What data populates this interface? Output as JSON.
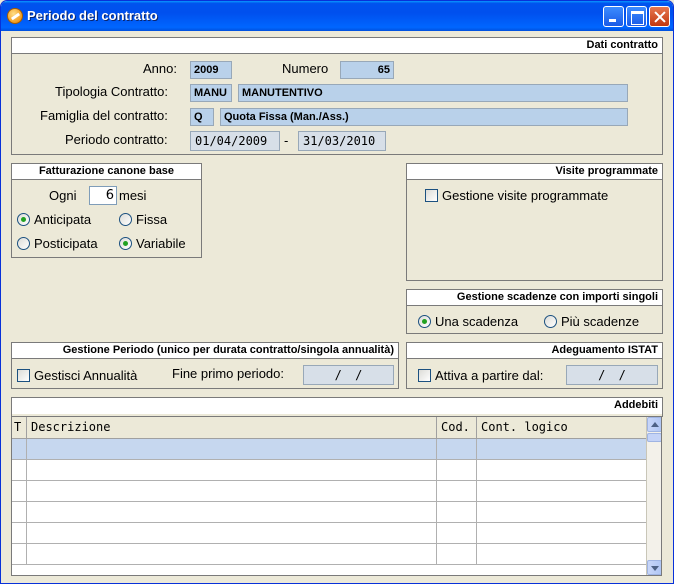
{
  "window": {
    "title": "Periodo del contratto"
  },
  "dati_contratto": {
    "header": "Dati contratto",
    "anno_label": "Anno:",
    "anno_value": "2009",
    "numero_label": "Numero",
    "numero_value": "65",
    "tipologia_label": "Tipologia Contratto:",
    "tipologia_code": "MANU",
    "tipologia_desc": "MANUTENTIVO",
    "famiglia_label": "Famiglia del contratto:",
    "famiglia_code": "Q",
    "famiglia_desc": "Quota Fissa (Man./Ass.)",
    "periodo_label": "Periodo contratto:",
    "periodo_from": "01/04/2009",
    "periodo_sep": "-",
    "periodo_to": "31/03/2010"
  },
  "fatturazione": {
    "header": "Fatturazione canone base",
    "ogni_label": "Ogni",
    "ogni_value": "6",
    "mesi_label": "mesi",
    "opt_anticipata": "Anticipata",
    "opt_fissa": "Fissa",
    "opt_posticipata": "Posticipata",
    "opt_variabile": "Variabile",
    "timing_selected": "Anticipata",
    "amount_selected": "Variabile"
  },
  "visite": {
    "header": "Visite programmate",
    "gestione_label": "Gestione visite programmate",
    "gestione_checked": false
  },
  "scadenze": {
    "header": "Gestione scadenze con importi singoli",
    "opt_una": "Una scadenza",
    "opt_piu": "Più scadenze",
    "selected": "Una scadenza"
  },
  "gestione_periodo": {
    "header": "Gestione Periodo (unico per durata contratto/singola annualità)",
    "gestisci_label": "Gestisci Annualità",
    "gestisci_checked": false,
    "fine_label": "Fine primo periodo:",
    "fine_value": "/ /"
  },
  "istat": {
    "header": "Adeguamento ISTAT",
    "attiva_label": "Attiva a partire dal:",
    "attiva_checked": false,
    "attiva_value": "/ /"
  },
  "addebiti": {
    "header": "Addebiti",
    "columns": [
      "T",
      "Descrizione",
      "Cod.",
      "Cont. logico"
    ],
    "rows": [
      [
        "",
        "",
        "",
        ""
      ],
      [
        "",
        "",
        "",
        ""
      ],
      [
        "",
        "",
        "",
        ""
      ],
      [
        "",
        "",
        "",
        ""
      ],
      [
        "",
        "",
        "",
        ""
      ],
      [
        "",
        "",
        "",
        ""
      ]
    ]
  },
  "icons": {
    "app": "app-icon",
    "minimize": "minimize-icon",
    "maximize": "maximize-icon",
    "close": "close-icon"
  }
}
